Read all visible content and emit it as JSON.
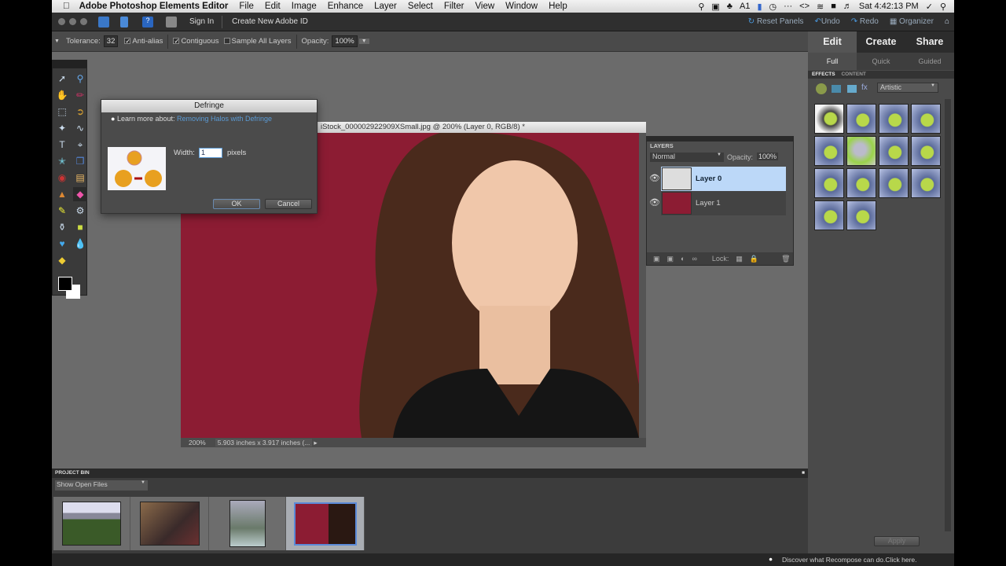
{
  "menubar": {
    "app_name": "Adobe Photoshop Elements Editor",
    "items": [
      "File",
      "Edit",
      "Image",
      "Enhance",
      "Layer",
      "Select",
      "Filter",
      "View",
      "Window",
      "Help"
    ],
    "clock": "Sat 4:42:13 PM",
    "adobe_badge": "1"
  },
  "app_toolbar": {
    "sign_in": "Sign In",
    "create_id": "Create New Adobe ID",
    "reset_panels": "Reset Panels",
    "undo": "Undo",
    "redo": "Redo",
    "organizer": "Organizer"
  },
  "options_bar": {
    "tolerance_label": "Tolerance:",
    "tolerance_value": "32",
    "anti_alias": {
      "label": "Anti-alias",
      "checked": true
    },
    "contiguous": {
      "label": "Contiguous",
      "checked": true
    },
    "sample_all": {
      "label": "Sample All Layers",
      "checked": false
    },
    "opacity_label": "Opacity:",
    "opacity_value": "100%"
  },
  "document": {
    "title": "iStock_000002922909XSmall.jpg @ 200% (Layer 0, RGB/8) *",
    "zoom": "200%",
    "dimensions": "5.903 inches x 3.917 inches (..."
  },
  "dialog": {
    "title": "Defringe",
    "learn_label": "Learn more about:",
    "learn_link": "Removing Halos with Defringe",
    "width_label": "Width:",
    "width_value": "1",
    "unit": "pixels",
    "ok": "OK",
    "cancel": "Cancel"
  },
  "layers_panel": {
    "tab": "LAYERS",
    "blend_mode": "Normal",
    "opacity_label": "Opacity:",
    "opacity_value": "100%",
    "layers": [
      {
        "name": "Layer 0",
        "selected": true,
        "visible": true
      },
      {
        "name": "Layer 1",
        "selected": false,
        "visible": true
      }
    ],
    "lock_label": "Lock:"
  },
  "right_panel": {
    "modes": [
      "Edit",
      "Create",
      "Share"
    ],
    "active_mode": "Edit",
    "submodes": [
      "Full",
      "Quick",
      "Guided"
    ],
    "active_submode": "Full",
    "tabs": [
      "EFFECTS",
      "CONTENT"
    ],
    "category": "Artistic",
    "effect_count": 14,
    "apply": "Apply"
  },
  "project_bin": {
    "title": "PROJECT BIN",
    "filter": "Show Open Files",
    "items": [
      {
        "name": "landscape-thumbnail",
        "selected": false
      },
      {
        "name": "party-room-thumbnail",
        "selected": false
      },
      {
        "name": "street-scene-thumbnail",
        "selected": false
      },
      {
        "name": "portrait-red-thumbnail",
        "selected": true
      }
    ]
  },
  "status_bar": {
    "hint": "Discover what Recompose can do.Click here."
  },
  "colors": {
    "canvas_bg": "#8c1c33",
    "selected_layer": "#bcd8f8",
    "link": "#5b9bd5"
  }
}
